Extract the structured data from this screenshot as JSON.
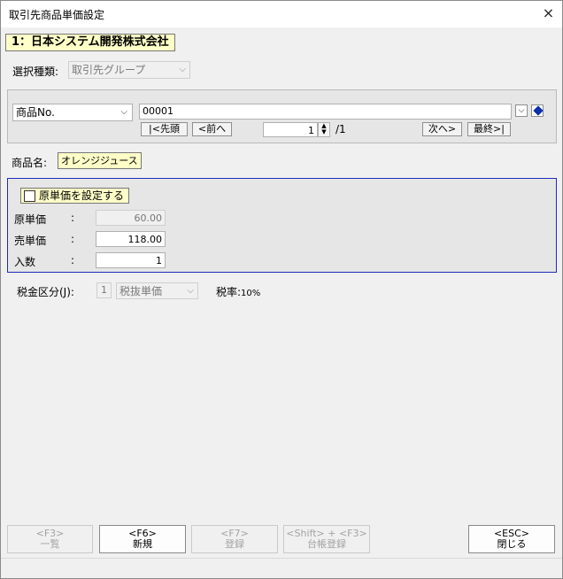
{
  "window": {
    "title": "取引先商品単価設定",
    "close_icon": "×"
  },
  "company": "1：日本システム開発株式会社",
  "selection": {
    "label": "選択種類:",
    "value": "取引先グループ"
  },
  "product_search": {
    "key_select": "商品No.",
    "code_value": "00001",
    "nav": {
      "first": "|<先頭",
      "prev": "<前へ",
      "next": "次へ>",
      "last": "最終>|"
    },
    "page_value": "1",
    "page_total": "/1"
  },
  "product_name": {
    "label": "商品名:",
    "value": "オレンジジュース"
  },
  "pricing": {
    "set_cost_checkbox_label": "原単価を設定する",
    "set_cost_checked": false,
    "rows": [
      {
        "label": "原単価",
        "colon": ":",
        "value": "60.00",
        "enabled": false
      },
      {
        "label": "売単価",
        "colon": ":",
        "value": "118.00",
        "enabled": true
      },
      {
        "label": "入数",
        "colon": ":",
        "value": "1",
        "enabled": true
      }
    ]
  },
  "tax": {
    "label": "税金区分(J):",
    "code": "1",
    "type": "税抜単価",
    "rate_label": "税率:",
    "rate_value": "10%"
  },
  "footer": {
    "buttons": [
      {
        "key": "<F3>",
        "label": "一覧",
        "enabled": false
      },
      {
        "key": "<F6>",
        "label": "新規",
        "enabled": true
      },
      {
        "key": "<F7>",
        "label": "登録",
        "enabled": false
      },
      {
        "key": "<Shift> + <F3>",
        "label": "台帳登録",
        "enabled": false
      },
      {
        "key": "<ESC>",
        "label": "閉じる",
        "enabled": true
      }
    ]
  }
}
